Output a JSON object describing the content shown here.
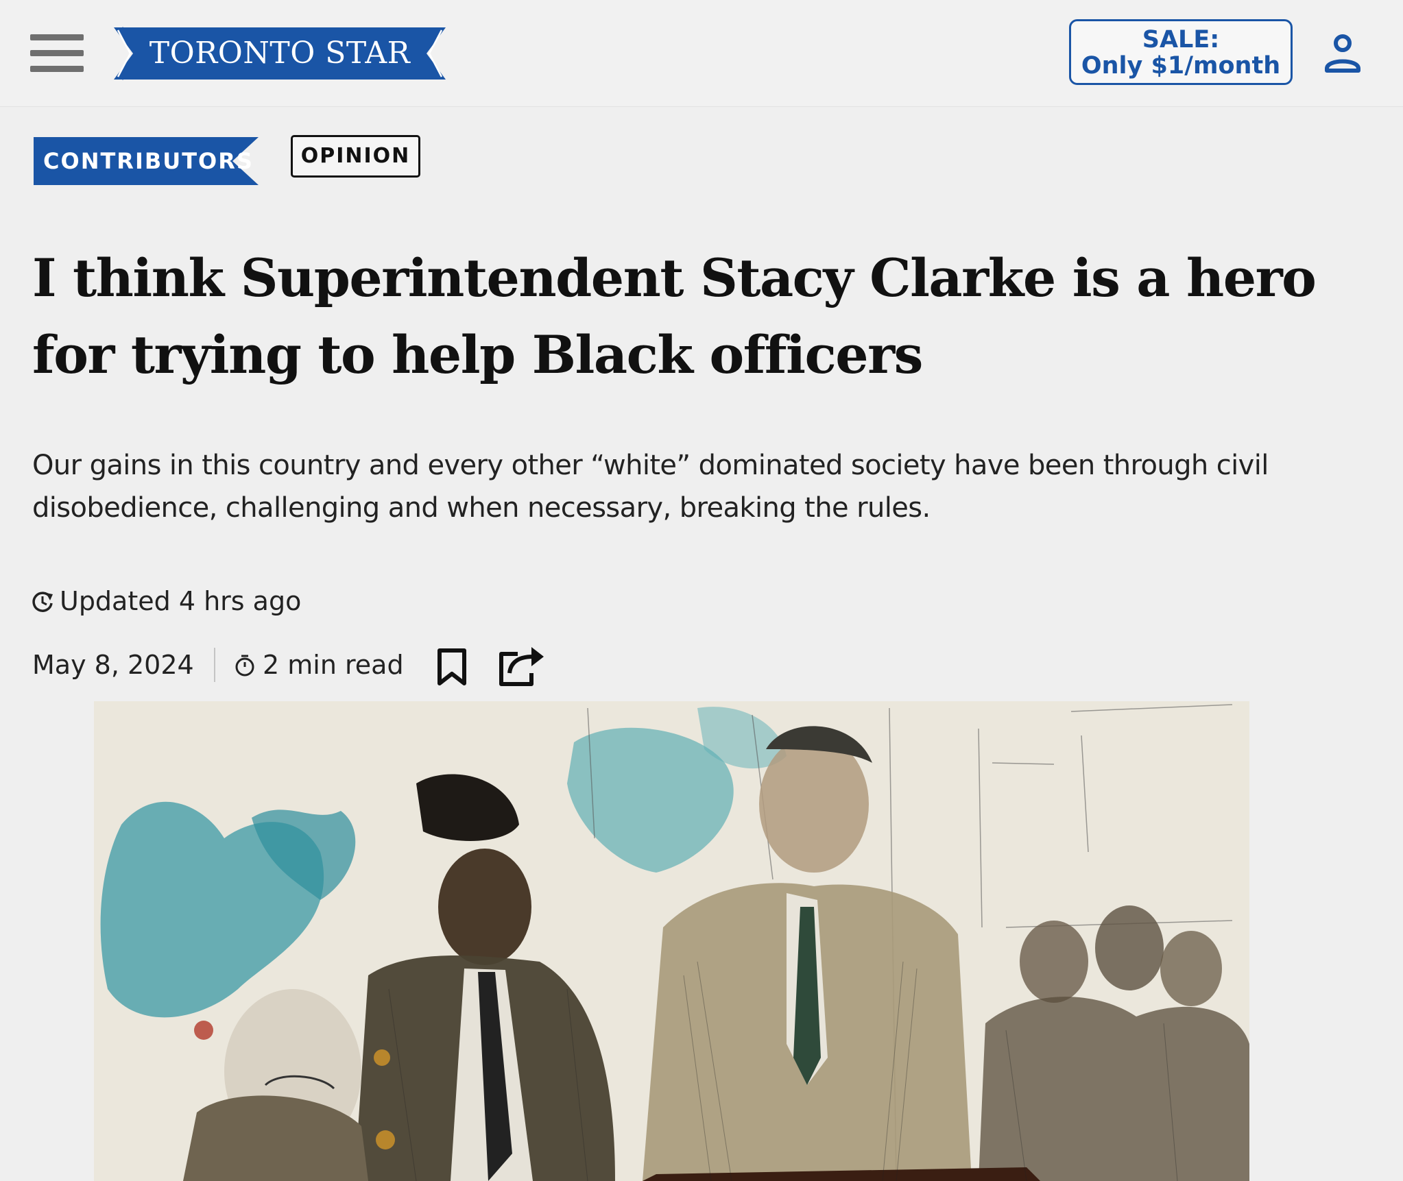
{
  "header": {
    "logo_text": "TORONTO STAR",
    "sale_line1": "SALE:",
    "sale_line2": "Only $1/month",
    "menu_icon": "hamburger-menu-icon",
    "account_icon": "user-account-icon"
  },
  "tags": {
    "section": "CONTRIBUTORS",
    "label": "OPINION"
  },
  "article": {
    "headline": "I think Superintendent Stacy Clarke is a hero for trying to help Black officers",
    "dek": "Our gains in this country and every other “white” dominated society have been through civil disobedience, challenging and when necessary, breaking the rules.",
    "updated": "Updated 4 hrs ago",
    "date": "May 8, 2024",
    "read_time": "2 min read"
  },
  "colors": {
    "brand_blue": "#1a55a6",
    "background": "#efefef",
    "text": "#111111"
  }
}
